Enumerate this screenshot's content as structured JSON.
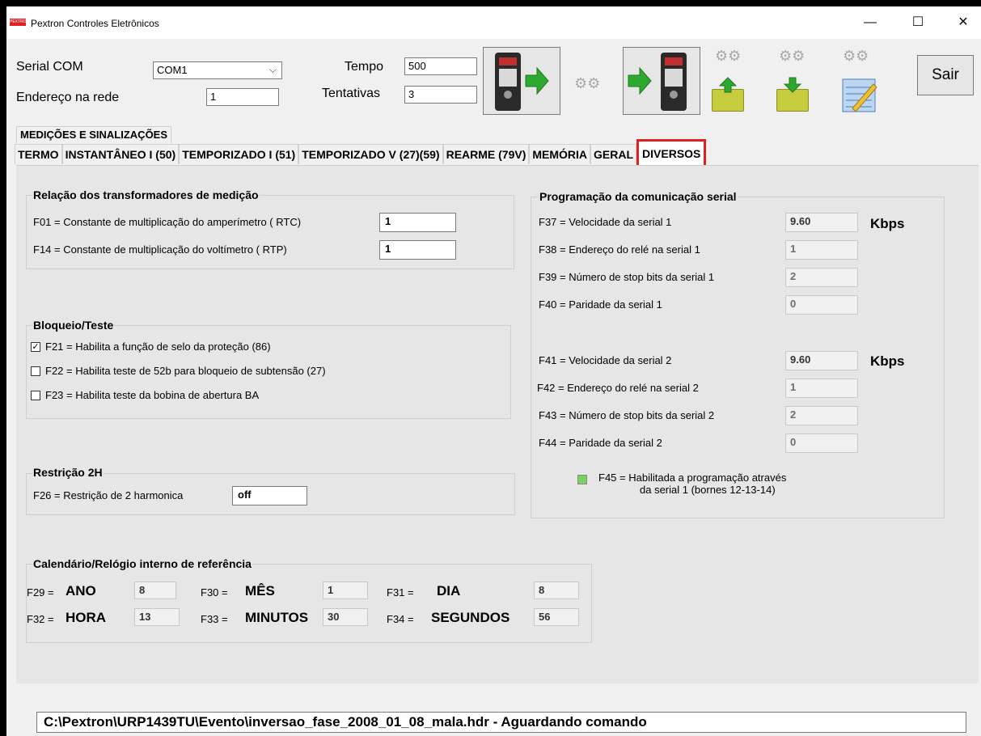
{
  "window": {
    "title": "Pextron Controles Eletrônicos",
    "app_icon_text": "PEXTRON",
    "minimize": "—",
    "maximize": "☐",
    "close": "✕"
  },
  "toolbar": {
    "serial_com_label": "Serial COM",
    "serial_com_value": "COM1",
    "address_label": "Endereço na rede",
    "address_value": "1",
    "tempo_label": "Tempo",
    "tempo_value": "500",
    "tentativas_label": "Tentativas",
    "tentativas_value": "3",
    "exit_label": "Sair"
  },
  "tabs": {
    "upper": "MEDIÇÕES E SINALIZAÇÕES",
    "items": [
      "TERMO",
      "INSTANTÂNEO I (50)",
      "TEMPORIZADO I (51)",
      "TEMPORIZADO V (27)(59)",
      "REARME (79V)",
      "MEMÓRIA",
      "GERAL",
      "DIVERSOS"
    ],
    "active": "DIVERSOS"
  },
  "transformers": {
    "title": "Relação dos transformadores de medição",
    "f01_label": "F01 = Constante de multiplicação do amperímetro ( RTC)",
    "f01_value": "1",
    "f14_label": "F14 = Constante de multiplicação do voltímetro ( RTP)",
    "f14_value": "1"
  },
  "block": {
    "title": "Bloqueio/Teste",
    "f21_label": "F21 = Habilita a função de selo da proteção (86)",
    "f21_checked": true,
    "f22_label": "F22 = Habilita teste de 52b para bloqueio de subtensão (27)",
    "f22_checked": false,
    "f23_label": "F23 = Habilita teste da bobina de abertura BA",
    "f23_checked": false
  },
  "restriction": {
    "title": "Restrição 2H",
    "f26_label": "F26 = Restrição de 2 harmonica",
    "f26_value": "off"
  },
  "calendar": {
    "title": "Calendário/Relógio interno de referência",
    "f29_code": "F29 =",
    "f29_name": "ANO",
    "f29_value": "8",
    "f30_code": "F30 =",
    "f30_name": "MÊS",
    "f30_value": "1",
    "f31_code": "F31 =",
    "f31_name": "DIA",
    "f31_value": "8",
    "f32_code": "F32 =",
    "f32_name": "HORA",
    "f32_value": "13",
    "f33_code": "F33 =",
    "f33_name": "MINUTOS",
    "f33_value": "30",
    "f34_code": "F34 =",
    "f34_name": "SEGUNDOS",
    "f34_value": "56"
  },
  "serial": {
    "title": "Programação da comunicação serial",
    "f37_label": "F37 = Velocidade da serial 1",
    "f37_value": "9.60",
    "kbps1": "Kbps",
    "f38_label": "F38 = Endereço do relé na serial 1",
    "f38_value": "1",
    "f39_label": "F39 = Número de stop bits da serial 1",
    "f39_value": "2",
    "f40_label": "F40 = Paridade da serial 1",
    "f40_value": "0",
    "f41_label": "F41 = Velocidade da serial 2",
    "f41_value": "9.60",
    "kbps2": "Kbps",
    "f42_label": "F42 = Endereço do relé na serial 2",
    "f42_value": "1",
    "f43_label": "F43 = Número de stop bits da serial 2",
    "f43_value": "2",
    "f44_label": "F44 = Paridade da serial 2",
    "f44_value": "0",
    "f45_line1": "F45 = Habilitada a programação através",
    "f45_line2": "da serial 1 (bornes 12-13-14)",
    "f45_indicator_color": "#7cd15b"
  },
  "status": {
    "text": "C:\\Pextron\\URP1439TU\\Evento\\inversao_fase_2008_01_08_mala.hdr - Aguardando comando"
  }
}
